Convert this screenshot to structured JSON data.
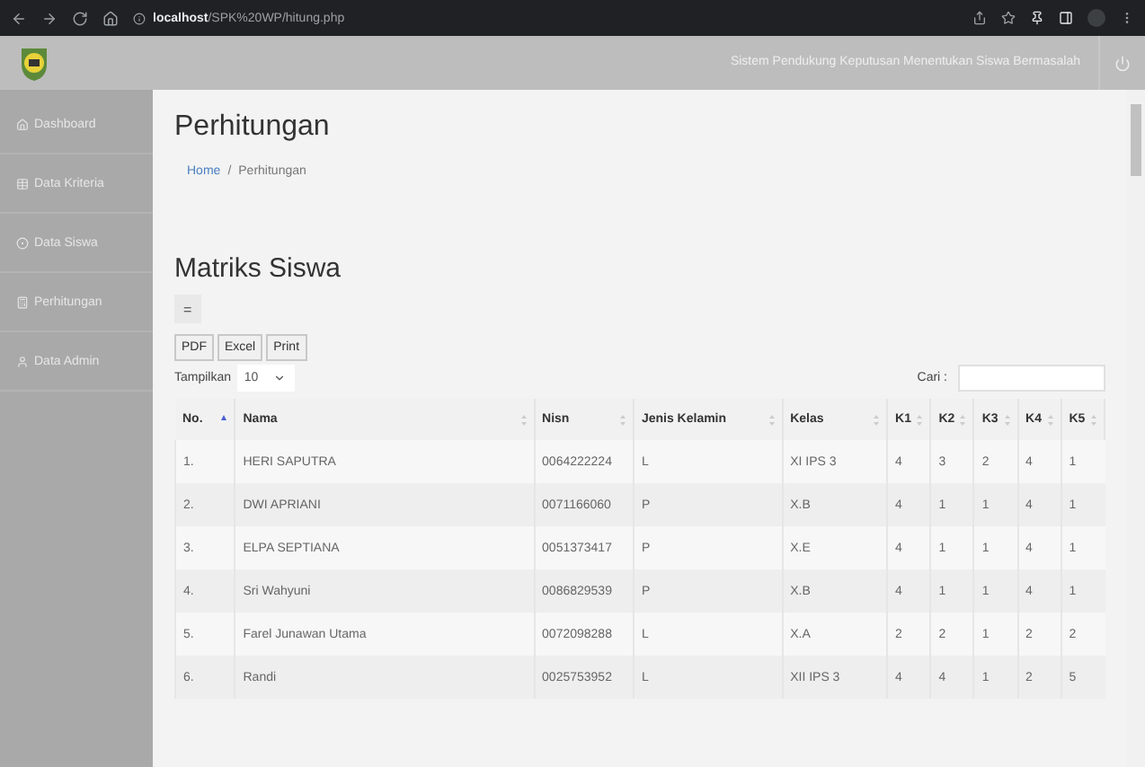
{
  "browser": {
    "url_host": "localhost",
    "url_path": "/SPK%20WP/hitung.php"
  },
  "header": {
    "title": "Sistem Pendukung Keputusan Menentukan Siswa Bermasalah"
  },
  "sidebar": {
    "items": [
      {
        "label": "Dashboard",
        "kind": "home"
      },
      {
        "label": "Data Kriteria",
        "kind": "table"
      },
      {
        "label": "Data Siswa",
        "kind": "circle"
      },
      {
        "label": "Perhitungan",
        "kind": "calc"
      },
      {
        "label": "Data Admin",
        "kind": "user"
      }
    ]
  },
  "page": {
    "title": "Perhitungan",
    "breadcrumb_separator": "/",
    "breadcrumb": [
      {
        "label": "Home",
        "link": true
      },
      {
        "label": "Perhitungan",
        "link": false
      }
    ]
  },
  "section": {
    "title": "Matriks Siswa",
    "toggle": "=",
    "buttons": [
      "PDF",
      "Excel",
      "Print"
    ],
    "length_label": "Tampilkan",
    "length_value": "10",
    "search_label": "Cari :"
  },
  "table": {
    "columns": [
      {
        "label": "No.",
        "sorted": true
      },
      {
        "label": "Nama",
        "sorted": false
      },
      {
        "label": "Nisn",
        "sorted": false
      },
      {
        "label": "Jenis Kelamin",
        "sorted": false
      },
      {
        "label": "Kelas",
        "sorted": false
      },
      {
        "label": "K1",
        "sorted": false
      },
      {
        "label": "K2",
        "sorted": false
      },
      {
        "label": "K3",
        "sorted": false
      },
      {
        "label": "K4",
        "sorted": false
      },
      {
        "label": "K5",
        "sorted": false
      }
    ],
    "rows": [
      [
        "1.",
        "HERI SAPUTRA",
        "0064222224",
        "L",
        "XI IPS 3",
        "4",
        "3",
        "2",
        "4",
        "1"
      ],
      [
        "2.",
        "DWI APRIANI",
        "0071166060",
        "P",
        "X.B",
        "4",
        "1",
        "1",
        "4",
        "1"
      ],
      [
        "3.",
        "ELPA SEPTIANA",
        "0051373417",
        "P",
        "X.E",
        "4",
        "1",
        "1",
        "4",
        "1"
      ],
      [
        "4.",
        "Sri Wahyuni",
        "0086829539",
        "P",
        "X.B",
        "4",
        "1",
        "1",
        "4",
        "1"
      ],
      [
        "5.",
        "Farel Junawan Utama",
        "0072098288",
        "L",
        "X.A",
        "2",
        "2",
        "1",
        "2",
        "2"
      ],
      [
        "6.",
        "Randi",
        "0025753952",
        "L",
        "XII IPS 3",
        "4",
        "4",
        "1",
        "2",
        "5"
      ]
    ]
  }
}
